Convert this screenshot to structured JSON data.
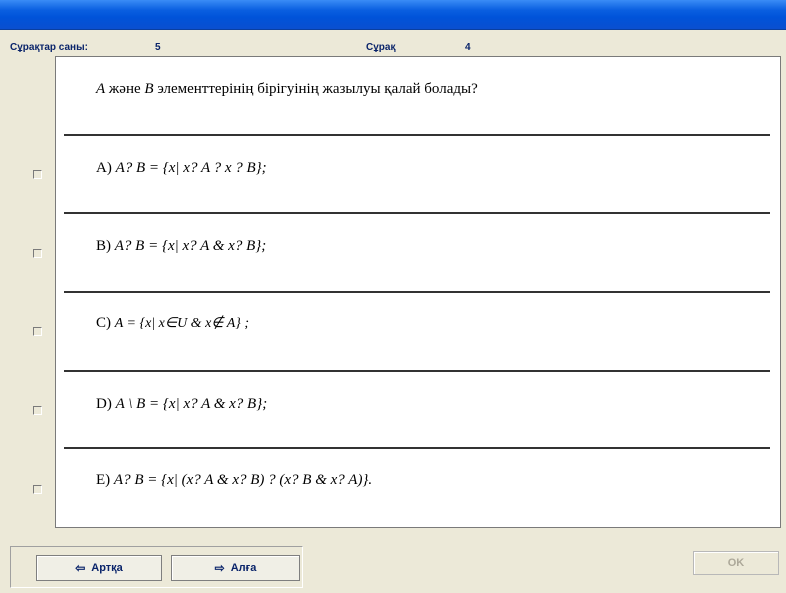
{
  "header": {
    "questions_count_label": "Сұрақтар саны:",
    "questions_count_value": "5",
    "question_label": "Сұрақ",
    "question_value": "4"
  },
  "question": {
    "var_a": "A",
    "mid": "және",
    "var_b": "B",
    "rest": "элементтерінің бірігуінің жазылуы қалай болады?"
  },
  "answers": [
    {
      "letter": "A)",
      "text": "A? B = {x| x? A ? x ? B};"
    },
    {
      "letter": "B)",
      "text": "A? B = {x| x? A & x? B};"
    },
    {
      "letter": "C)",
      "text": "A = {x| x∈U & x∉ A} ;"
    },
    {
      "letter": "D)",
      "text": "A \\ B = {x| x? A & x? B};"
    },
    {
      "letter": "E)",
      "text": "A? B = {x| (x? A & x? B) ? (x? B & x? A)}."
    }
  ],
  "buttons": {
    "back_label": "Артқа",
    "forward_label": "Алға",
    "ok_label": "OK"
  },
  "icons": {
    "back": "arrow-left-icon",
    "forward": "arrow-right-icon"
  },
  "colors": {
    "title_bar": "#0a5fe0",
    "header_text": "#0a246a",
    "window_bg": "#ece9d8"
  }
}
